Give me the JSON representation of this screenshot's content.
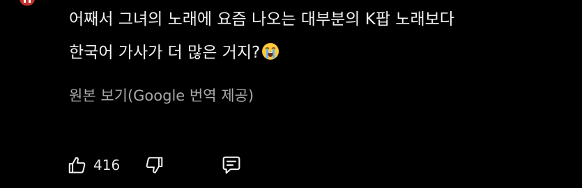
{
  "comment": {
    "line1": "어째서 그녀의 노래에 요즘 나오는 대부분의 K팝 노래보다",
    "line2": "한국어 가사가 더 많은 거지?",
    "emoji": "loudly-crying-face-emoji"
  },
  "translation": {
    "link_label": "원본 보기(Google 번역 제공)"
  },
  "actions": {
    "like_count": "416",
    "like_icon": "thumbs-up-icon",
    "dislike_icon": "thumbs-down-icon",
    "reply_icon": "comment-reply-icon"
  },
  "colors": {
    "background": "#000000",
    "text": "#f1f1f1",
    "secondary_text": "#aaaaaa",
    "avatar": "#c4302b"
  }
}
